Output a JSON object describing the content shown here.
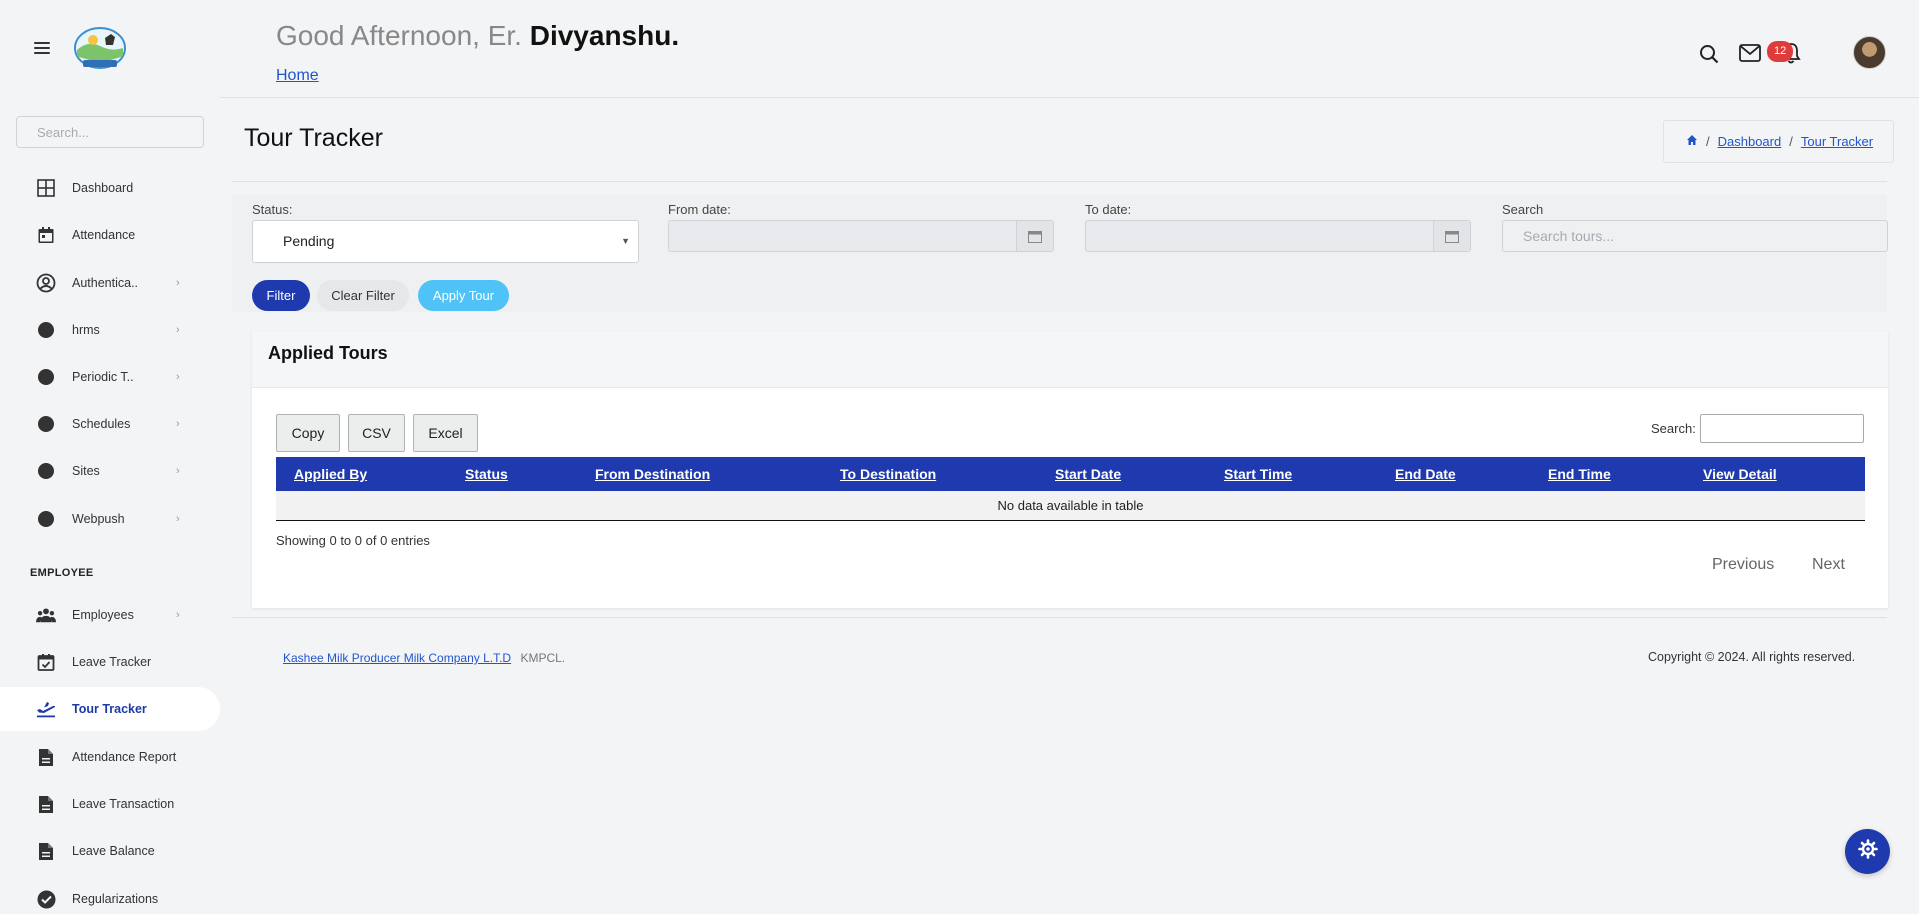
{
  "sidebar": {
    "search_placeholder": "Search...",
    "items": [
      {
        "label": "Dashboard"
      },
      {
        "label": "Attendance"
      },
      {
        "label": "Authentica.."
      },
      {
        "label": "hrms"
      },
      {
        "label": "Periodic T.."
      },
      {
        "label": "Schedules"
      },
      {
        "label": "Sites"
      },
      {
        "label": "Webpush"
      }
    ],
    "section_employee": "EMPLOYEE",
    "employee_items": [
      {
        "label": "Employees"
      },
      {
        "label": "Leave Tracker"
      },
      {
        "label": "Tour Tracker"
      },
      {
        "label": "Attendance Report"
      },
      {
        "label": "Leave Transaction"
      },
      {
        "label": "Leave Balance"
      },
      {
        "label": "Regularizations"
      }
    ],
    "chevron": "›"
  },
  "header": {
    "greeting_prefix": "Good Afternoon, Er.",
    "user_name": "Divyanshu",
    "greeting_suffix": ".",
    "home_link": "Home",
    "notification_count": "12",
    "colors": {
      "badge": "#e03b3b",
      "accent": "#1e3aae"
    }
  },
  "page": {
    "title": "Tour Tracker",
    "breadcrumb": {
      "sep": "/",
      "dashboard": "Dashboard",
      "current": "Tour Tracker"
    }
  },
  "filter": {
    "status_label": "Status:",
    "status_value": "Pending",
    "from_date_label": "From date:",
    "to_date_label": "To date:",
    "search_label": "Search",
    "search_placeholder": "Search tours...",
    "filter_button": "Filter",
    "clear_button": "Clear Filter",
    "apply_button": "Apply Tour"
  },
  "table": {
    "title": "Applied Tours",
    "buttons": {
      "copy": "Copy",
      "csv": "CSV",
      "excel": "Excel"
    },
    "search_label": "Search:",
    "columns": [
      "Applied By",
      "Status",
      "From Destination",
      "To Destination",
      "Start Date",
      "Start Time",
      "End Date",
      "End Time",
      "View Detail"
    ],
    "empty_message": "No data available in table",
    "info": "Showing 0 to 0 of 0 entries",
    "previous": "Previous",
    "next": "Next"
  },
  "footer": {
    "company_link": "Kashee Milk Producer Milk Company L.T.D",
    "company_short": "KMPCL.",
    "copyright": "Copyright © 2024. All rights reserved."
  }
}
